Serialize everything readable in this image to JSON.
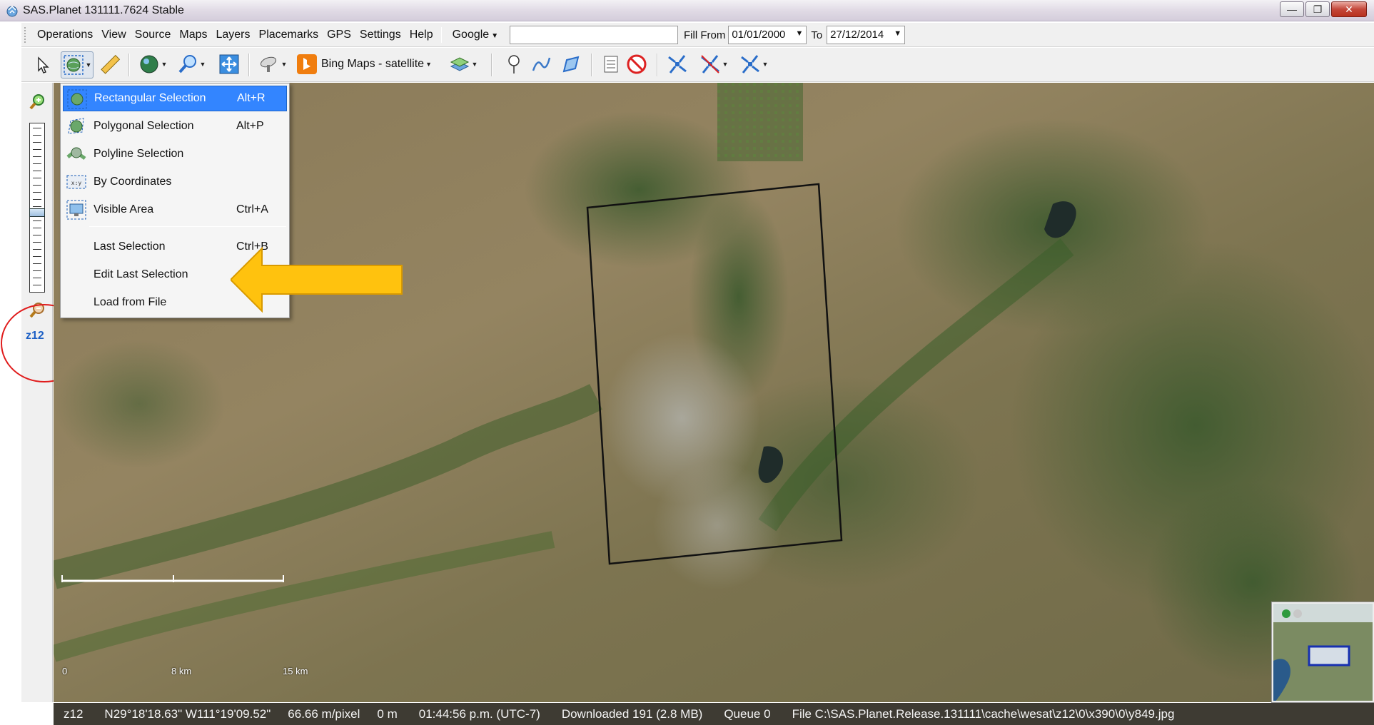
{
  "window": {
    "title": "SAS.Planet 131111.7624 Stable"
  },
  "menubar": {
    "items": [
      "Operations",
      "View",
      "Source",
      "Maps",
      "Layers",
      "Placemarks",
      "GPS",
      "Settings",
      "Help"
    ],
    "geocoder": "Google",
    "search_value": "",
    "fill_from_label": "Fill From",
    "fill_from_value": "01/01/2000",
    "to_label": "To",
    "to_value": "27/12/2014"
  },
  "toolbar": {
    "map_source_label": "Bing Maps - satellite"
  },
  "leftrail": {
    "zoom_level": "z12"
  },
  "selection_menu": {
    "items": [
      {
        "label": "Rectangular Selection",
        "shortcut": "Alt+R",
        "icon": "rectangle-select-icon",
        "selected": true
      },
      {
        "label": "Polygonal Selection",
        "shortcut": "Alt+P",
        "icon": "polygon-select-icon"
      },
      {
        "label": "Polyline Selection",
        "shortcut": "",
        "icon": "polyline-select-icon"
      },
      {
        "label": "By Coordinates",
        "shortcut": "",
        "icon": "coordinates-select-icon"
      },
      {
        "label": "Visible Area",
        "shortcut": "Ctrl+A",
        "icon": "visible-area-icon"
      },
      {
        "label": "Last Selection",
        "shortcut": "Ctrl+B"
      },
      {
        "label": "Edit Last Selection",
        "shortcut": ""
      },
      {
        "label": "Load from File",
        "shortcut": ""
      }
    ]
  },
  "map": {
    "scale_labels": [
      "0",
      "8 km",
      "15 km"
    ]
  },
  "statusbar": {
    "zoom": "z12",
    "coordinates": "N29°18'18.63\" W111°19'09.52\"",
    "resolution": "66.66 m/pixel",
    "altitude": "0 m",
    "time": "01:44:56 p.m. (UTC-7)",
    "downloaded": "Downloaded 191 (2.8 MB)",
    "queue": "Queue 0",
    "file": "File C:\\SAS.Planet.Release.131111\\cache\\wesat\\z12\\0\\x390\\0\\y849.jpg"
  },
  "colors": {
    "highlight": "#3385ff",
    "annotation_arrow": "#ffc20e",
    "annotation_circle": "#e01c1c",
    "statusbar_bg": "#3e3b33"
  }
}
